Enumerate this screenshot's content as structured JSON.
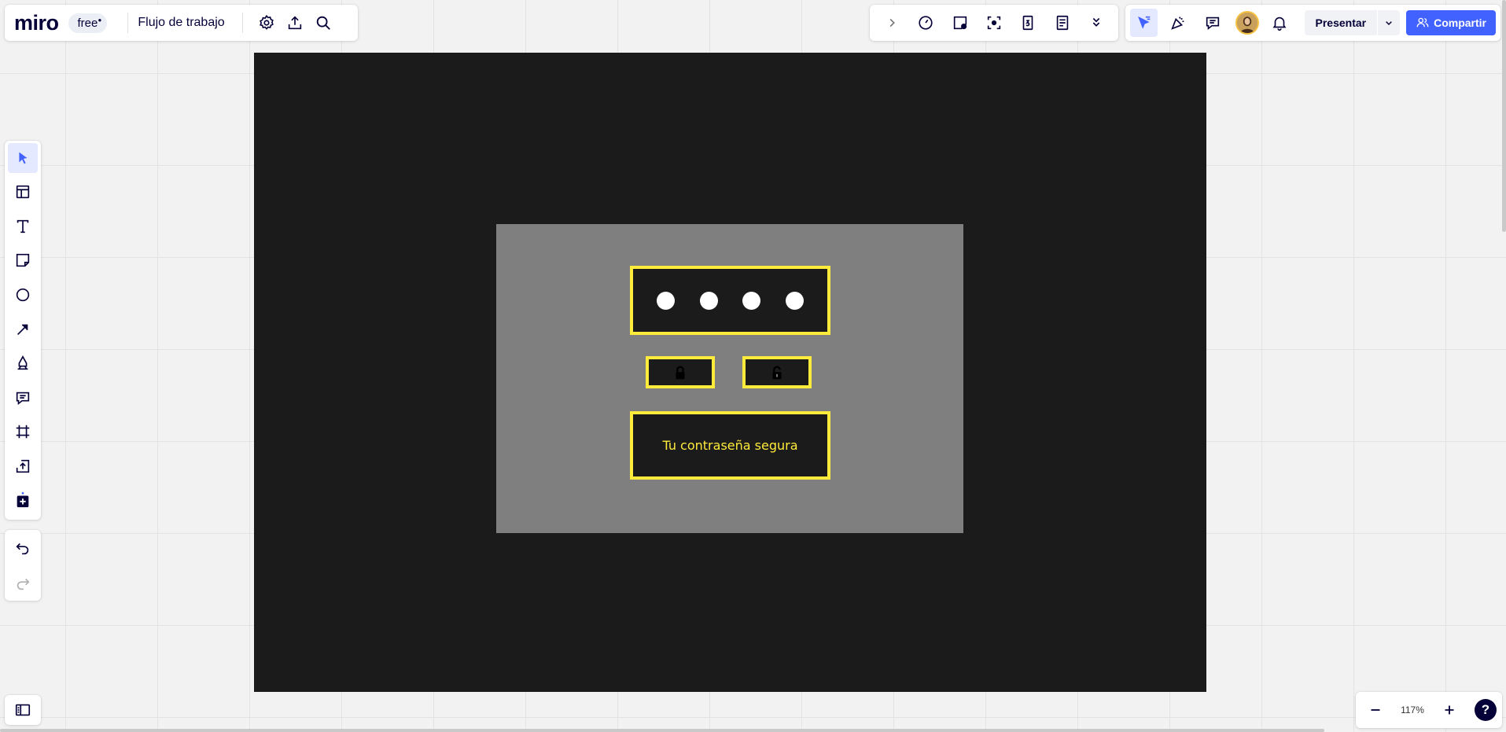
{
  "app": {
    "logo": "miro",
    "plan_badge": "free",
    "board_title": "Flujo de trabajo"
  },
  "collab": {
    "present_label": "Presentar",
    "share_label": "Compartir",
    "share_color": "#4262ff"
  },
  "zoom": {
    "level": "117%",
    "help_label": "?"
  },
  "board": {
    "frame_color": "#1b1b1b",
    "mockup_color": "#7f7f7f",
    "accent_color": "#ffeb3b",
    "pin_dot_count": 4,
    "password_label": "Tu contraseña segura"
  },
  "icons": {
    "top_left": [
      "settings-icon",
      "export-icon",
      "search-icon"
    ],
    "top_tools": [
      "chevron-right-icon",
      "timer-icon",
      "sticky-add-icon",
      "focus-icon",
      "number-icon",
      "notes-icon",
      "double-chevron-down-icon"
    ],
    "collab": [
      "cursor-filter-icon",
      "reactions-icon",
      "comments-icon",
      "avatar",
      "bell-icon"
    ],
    "left_tools": [
      "select-icon",
      "templates-icon",
      "text-icon",
      "sticky-note-icon",
      "shape-icon",
      "arrow-icon",
      "pen-icon",
      "comment-icon",
      "frame-icon",
      "upload-icon",
      "add-app-icon"
    ]
  }
}
